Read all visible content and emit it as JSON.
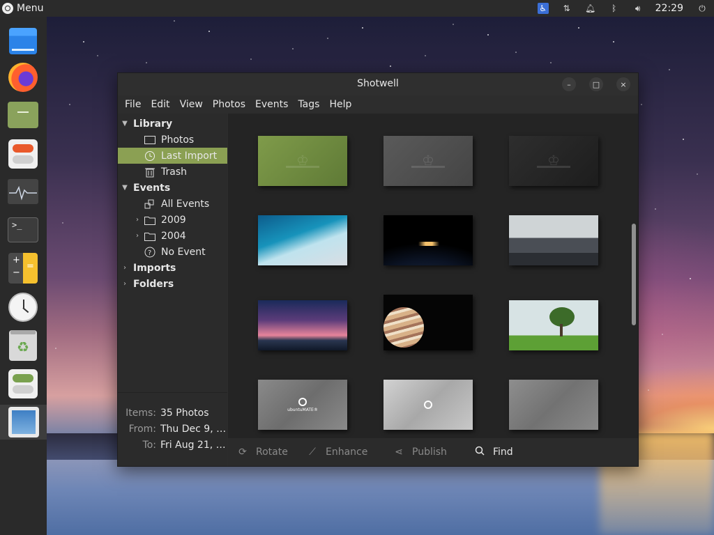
{
  "desktop": {
    "top_panel": {
      "menu_label": "Menu",
      "clock": "22:29"
    },
    "dock": {
      "items": [
        "files",
        "firefox",
        "file-manager",
        "settings",
        "system-monitor",
        "terminal",
        "calculator",
        "clock",
        "trash",
        "tweak-tool",
        "shotwell"
      ]
    }
  },
  "window": {
    "title": "Shotwell",
    "controls": {
      "minimize": "–",
      "maximize": "□",
      "close": "×"
    },
    "menu": [
      "File",
      "Edit",
      "View",
      "Photos",
      "Events",
      "Tags",
      "Help"
    ],
    "sidebar": {
      "library_header": "Library",
      "library_items": [
        {
          "label": "Photos",
          "icon": "photos-icon"
        },
        {
          "label": "Last Import",
          "icon": "clock-icon",
          "selected": true
        },
        {
          "label": "Trash",
          "icon": "trash-icon"
        }
      ],
      "events_header": "Events",
      "events_items": [
        {
          "label": "All Events",
          "icon": "all-events-icon"
        },
        {
          "label": "2009",
          "icon": "folder-icon",
          "expandable": true
        },
        {
          "label": "2004",
          "icon": "folder-icon",
          "expandable": true
        },
        {
          "label": "No Event",
          "icon": "question-icon"
        }
      ],
      "imports_header": "Imports",
      "folders_header": "Folders",
      "stats": {
        "items_label": "Items:",
        "items_value": "35 Photos",
        "from_label": "From:",
        "from_value": "Thu Dec 9, …",
        "to_label": "To:",
        "to_value": "Fri Aug 21, …"
      }
    },
    "photos": [
      {
        "theme": "green-crown"
      },
      {
        "theme": "grey-crown"
      },
      {
        "theme": "dark-crown"
      },
      {
        "theme": "ocean-waves"
      },
      {
        "theme": "earth-night"
      },
      {
        "theme": "mountain"
      },
      {
        "theme": "milky-way"
      },
      {
        "theme": "jupiter"
      },
      {
        "theme": "lone-tree"
      },
      {
        "theme": "ubuntu-mate-poly",
        "caption": "ubuntuMATE®"
      },
      {
        "theme": "light-poly"
      },
      {
        "theme": "grey-poly"
      }
    ],
    "toolbar": {
      "rotate": "Rotate",
      "enhance": "Enhance",
      "publish": "Publish",
      "find": "Find"
    }
  }
}
